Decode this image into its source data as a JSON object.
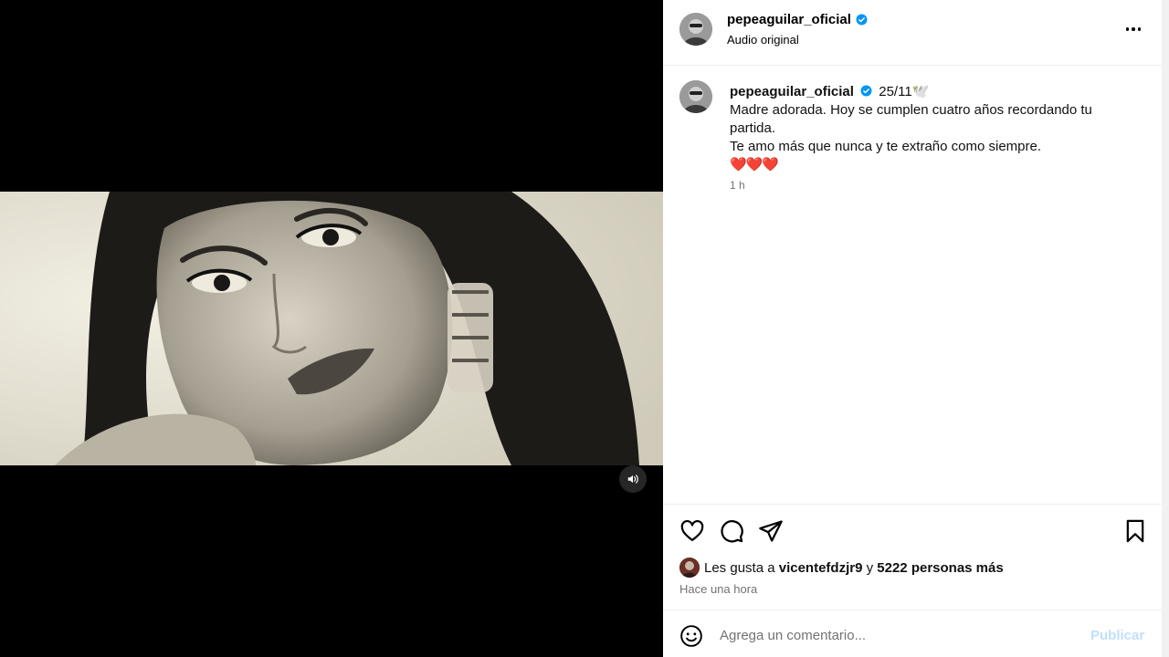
{
  "post": {
    "username": "pepeaguilar_oficial",
    "audio_label": "Audio original",
    "caption_date": "25/11🕊️",
    "caption_lines": [
      "Madre adorada. Hoy se cumplen cuatro años recordando tu partida.",
      "Te amo más que nunca y te extraño como siempre."
    ],
    "caption_hearts": "❤️❤️❤️",
    "caption_time": "1 h"
  },
  "likes": {
    "prefix": "Les gusta a",
    "user": "vicentefdzjr9",
    "connector": "y",
    "others": "5222 personas más"
  },
  "posted_ago": "Hace una hora",
  "comment": {
    "placeholder": "Agrega un comentario...",
    "publish_label": "Publicar"
  },
  "icons": {
    "verified": "verified-badge-icon",
    "more": "more-options-icon",
    "like": "heart-icon",
    "comment": "comment-bubble-icon",
    "share": "paper-plane-icon",
    "save": "bookmark-icon",
    "sound": "speaker-icon",
    "emoji": "smiley-icon"
  },
  "colors": {
    "verified_blue": "#0095f6",
    "publish_disabled": "#c0dffd",
    "muted_text": "#737373",
    "divider": "#efefef"
  }
}
